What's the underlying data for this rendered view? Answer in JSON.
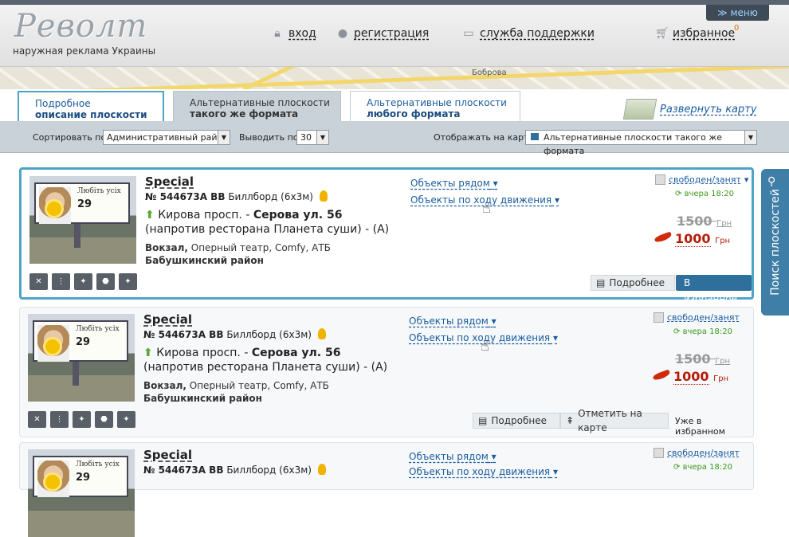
{
  "header": {
    "logo": "Револт",
    "tagline": "наружная реклама Украины",
    "menu_label": "≫ меню",
    "login": "вход",
    "register": "регистрация",
    "support": "служба поддержки",
    "favorites": "избранное",
    "favorites_count": "0"
  },
  "map_strip": {
    "labels": [
      "Боброва"
    ]
  },
  "tabs": [
    {
      "line1": "Подробное",
      "line2": "описание плоскости"
    },
    {
      "line1": "Альтернативные плоскости",
      "line2": "такого же формата"
    },
    {
      "line1": "Альтернативные плоскости",
      "line2": "любого формата"
    }
  ],
  "expand_map": "Развернуть карту",
  "filters": {
    "sort_label": "Сортировать по",
    "sort_value": "Административный район",
    "show_label": "Выводить по",
    "show_value": "30",
    "map_label": "Отображать на карте",
    "map_value": "Альтернативные плоскости такого же формата"
  },
  "side_tab": "Поиск плоскостей",
  "listings": [
    {
      "title": "Special",
      "code": "№ 544673А ВВ",
      "type": "Биллборд (6х3м)",
      "street1": "Кирова просп.",
      "sep": " - ",
      "street2": "Серова ул. 56",
      "landmark": "(напротив ресторана Планета суши) - (А)",
      "near_bold": "Вокзал,",
      "near_rest": " Оперный театр, Comfy, АТБ",
      "district": "Бабушкинский район",
      "nearby_link": "Объекты рядом",
      "route_link": "Объекты по ходу движения",
      "status": "свободен/занят",
      "date": "вчера 18:20",
      "old_price": "1500",
      "new_price": "1000",
      "currency": "Грн",
      "more": "Подробнее",
      "to_fav": "В избранное",
      "billboard_text": "Любіть усіх",
      "billboard_num": "29"
    },
    {
      "title": "Special",
      "code": "№ 544673А ВВ",
      "type": "Биллборд (6х3м)",
      "street1": "Кирова просп.",
      "sep": " - ",
      "street2": "Серова ул. 56",
      "landmark": "(напротив ресторана Планета суши) - (А)",
      "near_bold": "Вокзал,",
      "near_rest": " Оперный театр, Comfy, АТБ",
      "district": "Бабушкинский район",
      "nearby_link": "Объекты рядом",
      "route_link": "Объекты по ходу движения",
      "status": "свободен/занят",
      "date": "вчера 18:20",
      "old_price": "1500",
      "new_price": "1000",
      "currency": "Грн",
      "more": "Подробнее",
      "mark_map": "Отметить на карте",
      "in_fav": "Уже в избранном",
      "billboard_text": "Любіть усіх",
      "billboard_num": "29"
    },
    {
      "title": "Special",
      "code": "№ 544673А ВВ",
      "type": "Биллборд (6х3м)",
      "nearby_link": "Объекты рядом",
      "route_link": "Объекты по ходу движения",
      "status": "свободен/занят",
      "date": "вчера 18:20",
      "billboard_text": "Любіть усіх",
      "billboard_num": "29"
    }
  ],
  "colors": {
    "accent": "#4ea3c8",
    "price": "#b51d0a",
    "link": "#1a5ca0",
    "date": "#3a9a1a"
  }
}
